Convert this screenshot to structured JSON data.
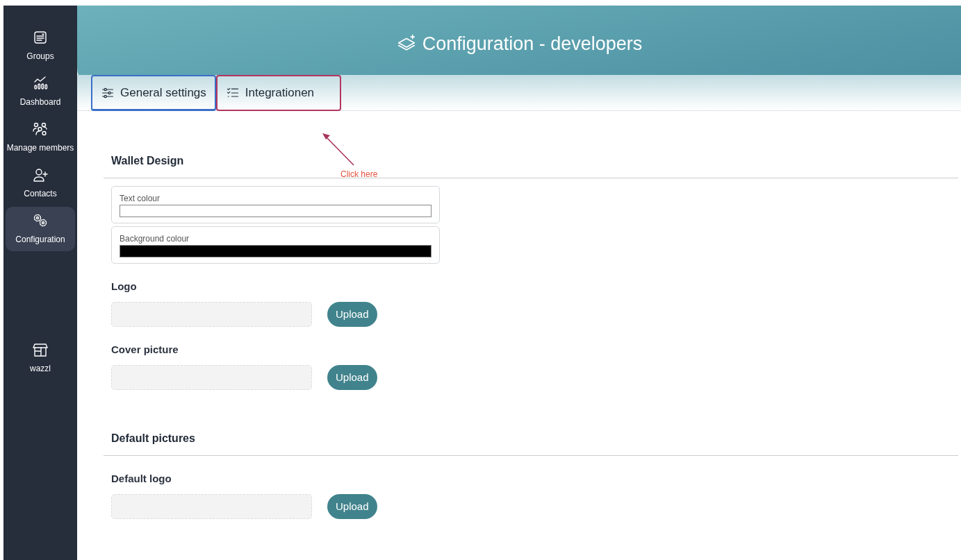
{
  "sidebar": {
    "items": [
      {
        "label": "Groups",
        "kind": "groups",
        "selected": false
      },
      {
        "label": "Dashboard",
        "kind": "dashboard",
        "selected": false
      },
      {
        "label": "Manage members",
        "kind": "members",
        "selected": false
      },
      {
        "label": "Contacts",
        "kind": "contacts",
        "selected": false
      },
      {
        "label": "Configuration",
        "kind": "config",
        "selected": true
      }
    ],
    "bottom_item": {
      "label": "wazzl",
      "kind": "store"
    }
  },
  "header": {
    "title": "Configuration - developers"
  },
  "tabs": [
    {
      "label": "General settings",
      "kind": "sliders",
      "selected": true,
      "highlighted": false
    },
    {
      "label": "Integrationen",
      "kind": "checklist",
      "selected": false,
      "highlighted": true
    }
  ],
  "annotation": {
    "text": "Click here"
  },
  "sections": [
    {
      "title": "Wallet Design",
      "fields": [
        {
          "kind": "color",
          "label": "Text colour",
          "color": "#ffffff"
        },
        {
          "kind": "color",
          "label": "Background colour",
          "color": "#000000"
        },
        {
          "kind": "upload",
          "label": "Logo",
          "button": "Upload"
        },
        {
          "kind": "upload",
          "label": "Cover picture",
          "button": "Upload"
        }
      ]
    },
    {
      "title": "Default pictures",
      "fields": [
        {
          "kind": "upload",
          "label": "Default logo",
          "button": "Upload"
        }
      ]
    }
  ]
}
